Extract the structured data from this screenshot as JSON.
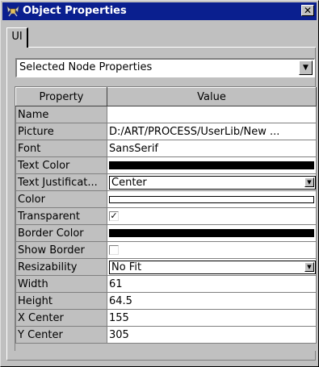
{
  "window": {
    "title": "Object Properties",
    "close_symbol": "✕",
    "icon": "object-properties-icon"
  },
  "tabs": [
    {
      "label": "UI",
      "selected": true
    }
  ],
  "selector": {
    "value": "Selected Node Properties",
    "arrow": "▼"
  },
  "table": {
    "headers": {
      "property": "Property",
      "value": "Value"
    },
    "rows": [
      {
        "property": "Name",
        "type": "text",
        "value": ""
      },
      {
        "property": "Picture",
        "type": "text",
        "value": "D:/ART/PROCESS/UserLib/New ..."
      },
      {
        "property": "Font",
        "type": "text",
        "value": "SansSerif"
      },
      {
        "property": "Text Color",
        "type": "color",
        "value": "#000000"
      },
      {
        "property": "Text Justificat...",
        "type": "select",
        "value": "Center"
      },
      {
        "property": "Color",
        "type": "color",
        "value": "#ffffff"
      },
      {
        "property": "Transparent",
        "type": "checkbox",
        "checked": true
      },
      {
        "property": "Border Color",
        "type": "color",
        "value": "#000000"
      },
      {
        "property": "Show Border",
        "type": "checkbox",
        "checked": false
      },
      {
        "property": "Resizability",
        "type": "select",
        "value": "No Fit"
      },
      {
        "property": "Width",
        "type": "text",
        "value": "61"
      },
      {
        "property": "Height",
        "type": "text",
        "value": "64.5"
      },
      {
        "property": "X Center",
        "type": "text",
        "value": "155"
      },
      {
        "property": "Y Center",
        "type": "text",
        "value": "305"
      }
    ]
  },
  "colors": {
    "title_bar": "#0a1f8f",
    "window_face": "#c0c0c0"
  }
}
